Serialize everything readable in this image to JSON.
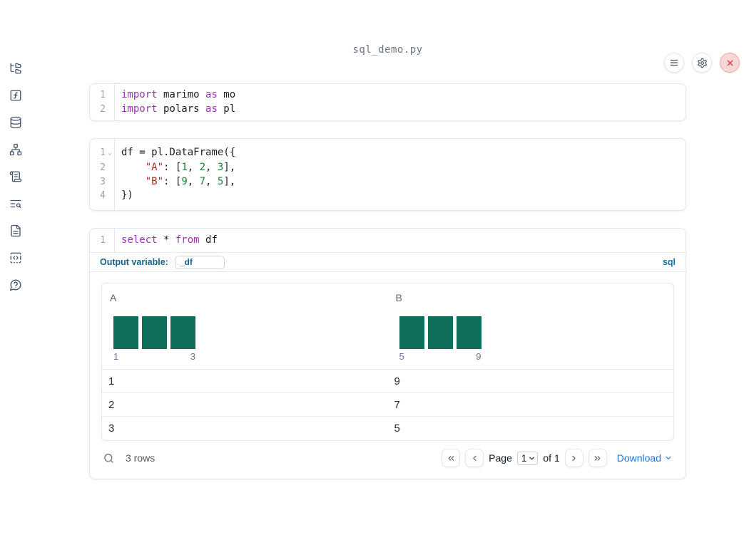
{
  "app": {
    "title": "sql_demo.py"
  },
  "topbar": {
    "buttons": [
      "menu",
      "settings",
      "close"
    ]
  },
  "sidebar": {
    "items": [
      {
        "name": "file-explorer"
      },
      {
        "name": "variables"
      },
      {
        "name": "data-sources"
      },
      {
        "name": "dependency-graph"
      },
      {
        "name": "logs"
      },
      {
        "name": "documentation-search"
      },
      {
        "name": "scratchpad"
      },
      {
        "name": "snippets"
      },
      {
        "name": "help"
      }
    ]
  },
  "cells": [
    {
      "lines": [
        {
          "num": "1",
          "tokens": [
            {
              "t": "import",
              "c": "kw"
            },
            {
              "t": " marimo ",
              "c": "pl"
            },
            {
              "t": "as",
              "c": "kw"
            },
            {
              "t": " mo",
              "c": "pl"
            }
          ]
        },
        {
          "num": "2",
          "tokens": [
            {
              "t": "import",
              "c": "kw"
            },
            {
              "t": " polars ",
              "c": "pl"
            },
            {
              "t": "as",
              "c": "kw"
            },
            {
              "t": " pl",
              "c": "pl"
            }
          ]
        }
      ]
    },
    {
      "lines": [
        {
          "num": "1",
          "fold": true,
          "tokens": [
            {
              "t": "df = pl.DataFrame({",
              "c": "pl"
            }
          ]
        },
        {
          "num": "2",
          "tokens": [
            {
              "t": "    ",
              "c": "pl"
            },
            {
              "t": "\"A\"",
              "c": "str"
            },
            {
              "t": ": [",
              "c": "pl"
            },
            {
              "t": "1",
              "c": "num"
            },
            {
              "t": ", ",
              "c": "pl"
            },
            {
              "t": "2",
              "c": "num"
            },
            {
              "t": ", ",
              "c": "pl"
            },
            {
              "t": "3",
              "c": "num"
            },
            {
              "t": "],",
              "c": "pl"
            }
          ]
        },
        {
          "num": "3",
          "tokens": [
            {
              "t": "    ",
              "c": "pl"
            },
            {
              "t": "\"B\"",
              "c": "str"
            },
            {
              "t": ": [",
              "c": "pl"
            },
            {
              "t": "9",
              "c": "num"
            },
            {
              "t": ", ",
              "c": "pl"
            },
            {
              "t": "7",
              "c": "num"
            },
            {
              "t": ", ",
              "c": "pl"
            },
            {
              "t": "5",
              "c": "num"
            },
            {
              "t": "],",
              "c": "pl"
            }
          ]
        },
        {
          "num": "4",
          "tokens": [
            {
              "t": "})",
              "c": "pl"
            }
          ]
        }
      ]
    },
    {
      "lines": [
        {
          "num": "1",
          "tokens": [
            {
              "t": "select",
              "c": "kw"
            },
            {
              "t": " * ",
              "c": "pl"
            },
            {
              "t": "from",
              "c": "kw"
            },
            {
              "t": " df",
              "c": "pl"
            }
          ]
        }
      ],
      "output_variable": {
        "label": "Output variable:",
        "value": "_df"
      },
      "language_label": "sql"
    }
  ],
  "output": {
    "table": {
      "columns": [
        {
          "name": "A",
          "histogram": {
            "bar_count": 3,
            "min_label": "1",
            "max_label": "3",
            "bar_color": "#0e6e59",
            "values": [
              1,
              2,
              3
            ]
          }
        },
        {
          "name": "B",
          "histogram": {
            "bar_count": 3,
            "min_label": "5",
            "max_label": "9",
            "bar_color": "#0e6e59",
            "values": [
              9,
              7,
              5
            ]
          }
        }
      ],
      "rows": [
        [
          "1",
          "9"
        ],
        [
          "2",
          "7"
        ],
        [
          "3",
          "5"
        ]
      ],
      "footer": {
        "row_count": "3 rows",
        "page_label": "Page",
        "page_value": "1",
        "page_total": "of 1",
        "download_label": "Download"
      }
    }
  },
  "colors": {
    "histogram_teal": "#0e6e59",
    "link_blue": "#1a73e8",
    "sql_blue": "#1d72a5",
    "keyword_purple": "#9a35b4",
    "string_red": "#b22a1f",
    "number_green": "#1b7f3c",
    "close_red": "#d33a3a"
  }
}
